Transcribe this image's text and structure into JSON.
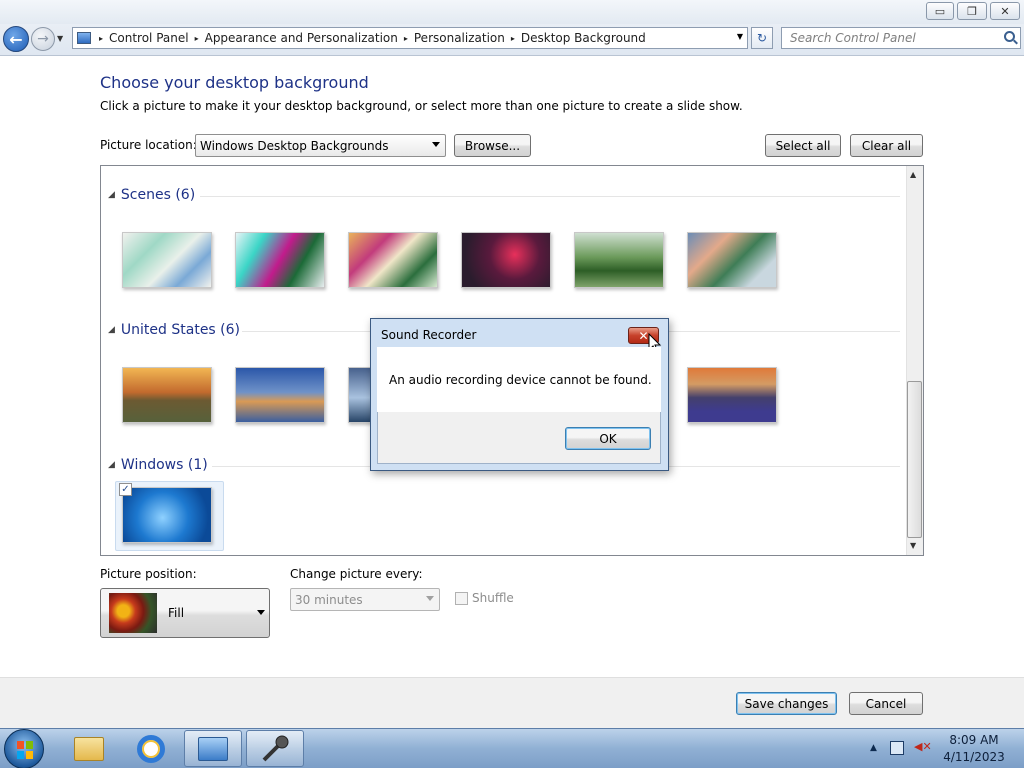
{
  "window": {
    "minimize": "▭",
    "restore": "❐",
    "close": "✕"
  },
  "nav": {
    "back": "←",
    "forward": "→",
    "history_drop": "▼",
    "breadcrumbs": [
      "Control Panel",
      "Appearance and Personalization",
      "Personalization",
      "Desktop Background"
    ],
    "breadcrumb_sep": "▸",
    "address_drop": "▼",
    "refresh": "↻",
    "search_placeholder": "Search Control Panel"
  },
  "page": {
    "title": "Choose your desktop background",
    "subtitle": "Click a picture to make it your desktop background, or select more than one picture to create a slide show.",
    "picture_location_label": "Picture location:",
    "picture_location_value": "Windows Desktop Backgrounds",
    "browse_label": "Browse...",
    "select_all_label": "Select all",
    "clear_all_label": "Clear all"
  },
  "groups": [
    {
      "name": "Scenes (6)",
      "toggle": "◢"
    },
    {
      "name": "United States (6)",
      "toggle": "◢"
    },
    {
      "name": "Windows (1)",
      "toggle": "◢"
    }
  ],
  "windows_checkbox": "✓",
  "options": {
    "position_label": "Picture position:",
    "position_value": "Fill",
    "change_label": "Change picture every:",
    "change_value": "30 minutes",
    "shuffle_label": "Shuffle"
  },
  "footer": {
    "save_label": "Save changes",
    "cancel_label": "Cancel"
  },
  "dialog": {
    "title": "Sound Recorder",
    "message": "An audio recording device cannot be found.",
    "ok_label": "OK",
    "close": "✕"
  },
  "taskbar": {
    "tray_arrow": "▲",
    "time": "8:09 AM",
    "date": "4/11/2023"
  },
  "colors": {
    "accent": "#1e3287",
    "taskbar": "#90b0d4",
    "dialog_frame": "#cfe0f3"
  }
}
